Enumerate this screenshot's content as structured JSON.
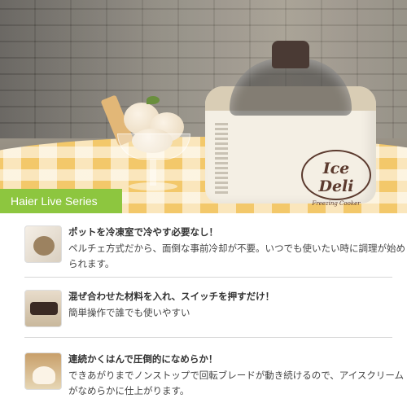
{
  "hero": {
    "logo_main": "Ice Deli",
    "logo_sub": "Freezing Cooker"
  },
  "badge": {
    "label": "Haier Live Series",
    "color": "#8dc63f"
  },
  "features": [
    {
      "title": "ポットを冷凍室で冷やす必要なし！",
      "text": "ペルチェ方式だから、面倒な事前冷却が不要。いつでも使いたい時に調理が始められます。"
    },
    {
      "title": "混ぜ合わせた材料を入れ、スイッチを押すだけ！",
      "text": "簡単操作で誰でも使いやすい"
    },
    {
      "title": "連続かくはんで圧倒的になめらか！",
      "text": "できあがりまでノンストップで回転ブレードが動き続けるので、アイスクリームがなめらかに仕上がります。"
    }
  ]
}
